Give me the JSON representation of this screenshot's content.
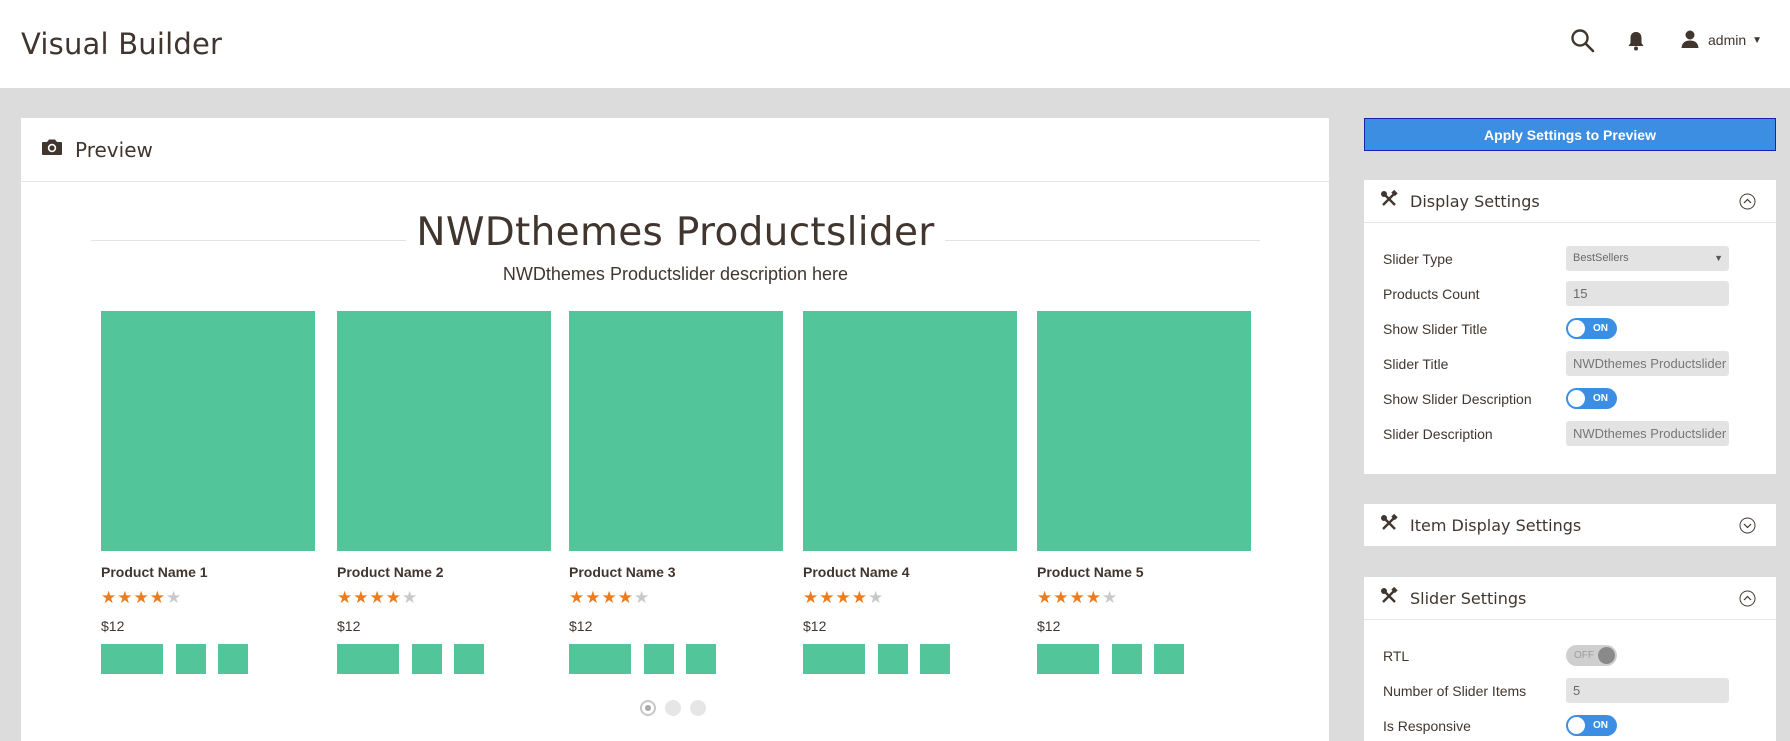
{
  "header": {
    "title": "Visual Builder",
    "user": "admin",
    "search_icon": "search-icon",
    "notification_icon": "bell-icon"
  },
  "preview": {
    "title": "Preview",
    "icon": "camera-icon",
    "slider_title": "NWDthemes Productslider",
    "slider_description": "NWDthemes Productslider description here",
    "products": [
      {
        "name": "Product Name 1",
        "rating": 4,
        "max_rating": 5,
        "price": "$12"
      },
      {
        "name": "Product Name 2",
        "rating": 4,
        "max_rating": 5,
        "price": "$12"
      },
      {
        "name": "Product Name 3",
        "rating": 4,
        "max_rating": 5,
        "price": "$12"
      },
      {
        "name": "Product Name 4",
        "rating": 4,
        "max_rating": 5,
        "price": "$12"
      },
      {
        "name": "Product Name 5",
        "rating": 4,
        "max_rating": 5,
        "price": "$12"
      }
    ],
    "pagination": {
      "pages": 3,
      "active": 1
    },
    "colors": {
      "product_placeholder": "#52c59b",
      "star_on": "#eb7d1e",
      "star_off": "#c9c9c9"
    }
  },
  "apply_button": "Apply Settings to Preview",
  "display_settings": {
    "title": "Display Settings",
    "icon": "tools-icon",
    "expanded": true,
    "fields": {
      "slider_type": {
        "label": "Slider Type",
        "value": "BestSellers"
      },
      "products_count": {
        "label": "Products Count",
        "value": "15"
      },
      "show_slider_title": {
        "label": "Show Slider Title",
        "state": "ON"
      },
      "slider_title": {
        "label": "Slider Title",
        "value": "NWDthemes Productslider"
      },
      "show_slider_description": {
        "label": "Show Slider Description",
        "state": "ON"
      },
      "slider_description": {
        "label": "Slider Description",
        "value": "NWDthemes Productslider description here"
      }
    }
  },
  "item_display_settings": {
    "title": "Item Display Settings",
    "icon": "tools-icon",
    "expanded": false
  },
  "slider_settings": {
    "title": "Slider Settings",
    "icon": "tools-icon",
    "expanded": true,
    "fields": {
      "rtl": {
        "label": "RTL",
        "state": "OFF"
      },
      "number_of_items": {
        "label": "Number of Slider Items",
        "value": "5"
      },
      "is_responsive": {
        "label": "Is Responsive",
        "state": "ON"
      }
    }
  },
  "colors": {
    "accent": "#3c8ee3",
    "background": "#dcdcdc"
  }
}
